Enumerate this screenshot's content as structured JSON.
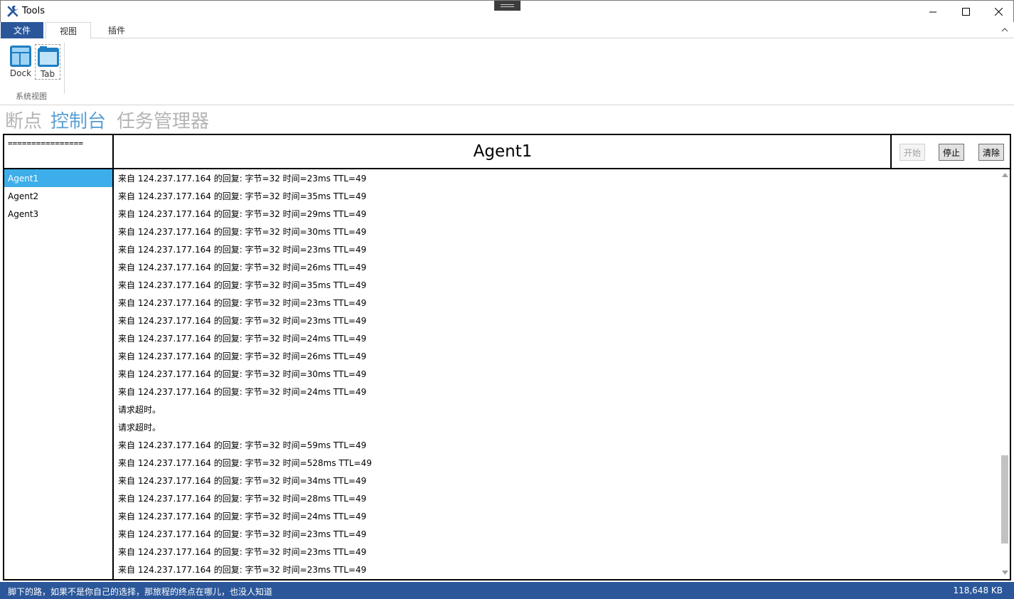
{
  "window": {
    "title": "Tools"
  },
  "ribbon": {
    "tabs": [
      "文件",
      "视图",
      "插件"
    ],
    "buttons": {
      "dock": "Dock",
      "tab": "Tab"
    },
    "group_label": "系统视图"
  },
  "page_tabs": [
    "断点",
    "控制台",
    "任务管理器"
  ],
  "panel": {
    "left_header": "================",
    "agent_title": "Agent1",
    "buttons": {
      "start": "开始",
      "stop": "停止",
      "clear": "清除"
    }
  },
  "agents": [
    "Agent1",
    "Agent2",
    "Agent3"
  ],
  "log_lines": [
    "来自 124.237.177.164 的回复: 字节=32 时间=23ms TTL=49",
    "来自 124.237.177.164 的回复: 字节=32 时间=35ms TTL=49",
    "来自 124.237.177.164 的回复: 字节=32 时间=29ms TTL=49",
    "来自 124.237.177.164 的回复: 字节=32 时间=30ms TTL=49",
    "来自 124.237.177.164 的回复: 字节=32 时间=23ms TTL=49",
    "来自 124.237.177.164 的回复: 字节=32 时间=26ms TTL=49",
    "来自 124.237.177.164 的回复: 字节=32 时间=35ms TTL=49",
    "来自 124.237.177.164 的回复: 字节=32 时间=23ms TTL=49",
    "来自 124.237.177.164 的回复: 字节=32 时间=23ms TTL=49",
    "来自 124.237.177.164 的回复: 字节=32 时间=24ms TTL=49",
    "来自 124.237.177.164 的回复: 字节=32 时间=26ms TTL=49",
    "来自 124.237.177.164 的回复: 字节=32 时间=30ms TTL=49",
    "来自 124.237.177.164 的回复: 字节=32 时间=24ms TTL=49",
    "请求超时。",
    "请求超时。",
    "来自 124.237.177.164 的回复: 字节=32 时间=59ms TTL=49",
    "来自 124.237.177.164 的回复: 字节=32 时间=528ms TTL=49",
    "来自 124.237.177.164 的回复: 字节=32 时间=34ms TTL=49",
    "来自 124.237.177.164 的回复: 字节=32 时间=28ms TTL=49",
    "来自 124.237.177.164 的回复: 字节=32 时间=24ms TTL=49",
    "来自 124.237.177.164 的回复: 字节=32 时间=23ms TTL=49",
    "来自 124.237.177.164 的回复: 字节=32 时间=23ms TTL=49",
    "来自 124.237.177.164 的回复: 字节=32 时间=23ms TTL=49"
  ],
  "status": {
    "message": "脚下的路，如果不是你自己的选择，那旅程的终点在哪儿，也没人知道",
    "memory": "118,648 KB"
  },
  "colors": {
    "accent": "#2b579a",
    "selected": "#3daee9",
    "active_tab": "#5a9fd4",
    "inactive_tab": "#b4b4b4"
  }
}
